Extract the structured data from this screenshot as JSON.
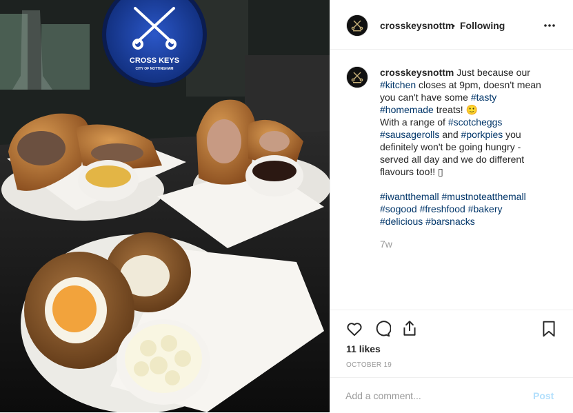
{
  "post": {
    "username": "crosskeysnottm",
    "separator": "•",
    "follow_state": "Following",
    "more_icon": "more-horizontal-icon",
    "caption": {
      "lines": [
        [
          {
            "t": "u",
            "v": "crosskeysnottm"
          },
          {
            "t": "x",
            "v": " Just because our"
          }
        ],
        [
          {
            "t": "h",
            "v": "#kitchen"
          },
          {
            "t": "x",
            "v": " closes at 9pm, doesn't mean"
          }
        ],
        [
          {
            "t": "x",
            "v": "you can't have some "
          },
          {
            "t": "h",
            "v": "#tasty"
          }
        ],
        [
          {
            "t": "h",
            "v": "#homemade"
          },
          {
            "t": "x",
            "v": " treats! 🙂"
          }
        ],
        [
          {
            "t": "x",
            "v": "With a range of "
          },
          {
            "t": "h",
            "v": "#scotcheggs"
          }
        ],
        [
          {
            "t": "h",
            "v": "#sausagerolls"
          },
          {
            "t": "x",
            "v": " and "
          },
          {
            "t": "h",
            "v": "#porkpies"
          },
          {
            "t": "x",
            "v": " you"
          }
        ],
        [
          {
            "t": "x",
            "v": "definitely won't be going hungry -"
          }
        ],
        [
          {
            "t": "x",
            "v": "served all day and we do different"
          }
        ],
        [
          {
            "t": "x",
            "v": "flavours too!! ▯"
          }
        ],
        [],
        [
          {
            "t": "h",
            "v": "#iwantthemall"
          },
          {
            "t": "x",
            "v": " "
          },
          {
            "t": "h",
            "v": "#mustnoteatthemall"
          }
        ],
        [
          {
            "t": "h",
            "v": "#sogood"
          },
          {
            "t": "x",
            "v": " "
          },
          {
            "t": "h",
            "v": "#freshfood"
          },
          {
            "t": "x",
            "v": " "
          },
          {
            "t": "h",
            "v": "#bakery"
          }
        ],
        [
          {
            "t": "h",
            "v": "#delicious"
          },
          {
            "t": "x",
            "v": " "
          },
          {
            "t": "h",
            "v": "#barsnacks"
          }
        ]
      ]
    },
    "age": "7w",
    "likes": "11 likes",
    "date": "OCTOBER 19",
    "comment_placeholder": "Add a comment...",
    "post_label": "Post",
    "icons": [
      "heart-icon",
      "comment-icon",
      "share-icon",
      "bookmark-icon"
    ]
  },
  "photo": {
    "sign_line1": "CROSS KEYS",
    "sign_line2": "CITY OF NOTTINGHAM"
  },
  "colors": {
    "hashtag": "#003569",
    "muted": "#999999",
    "post_disabled": "#b2dffc",
    "sign_blue": "#1d3f9a"
  }
}
